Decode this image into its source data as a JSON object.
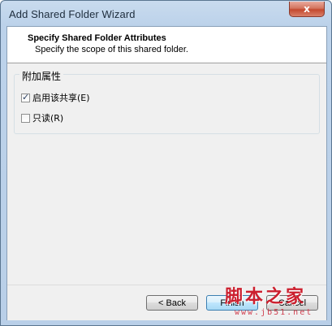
{
  "window": {
    "title": "Add Shared Folder Wizard",
    "close_glyph": "x"
  },
  "header": {
    "title": "Specify Shared Folder Attributes",
    "subtitle": "Specify the scope of this shared folder."
  },
  "attributes_group": {
    "title": "附加属性",
    "options": [
      {
        "label": "启用该共享(E)",
        "checked": true
      },
      {
        "label": "只读(R)",
        "checked": false
      }
    ]
  },
  "footer": {
    "back_label": "< Back",
    "finish_label": "Finish",
    "cancel_label": "Cancel"
  },
  "watermark": {
    "main": "脚本之家",
    "site": "www.jb51.net"
  },
  "colors": {
    "title_bar": "#bcd2ea",
    "close_button": "#c4492f",
    "dialog_background": "#f0f0f0",
    "watermark": "#cc1f2e"
  }
}
